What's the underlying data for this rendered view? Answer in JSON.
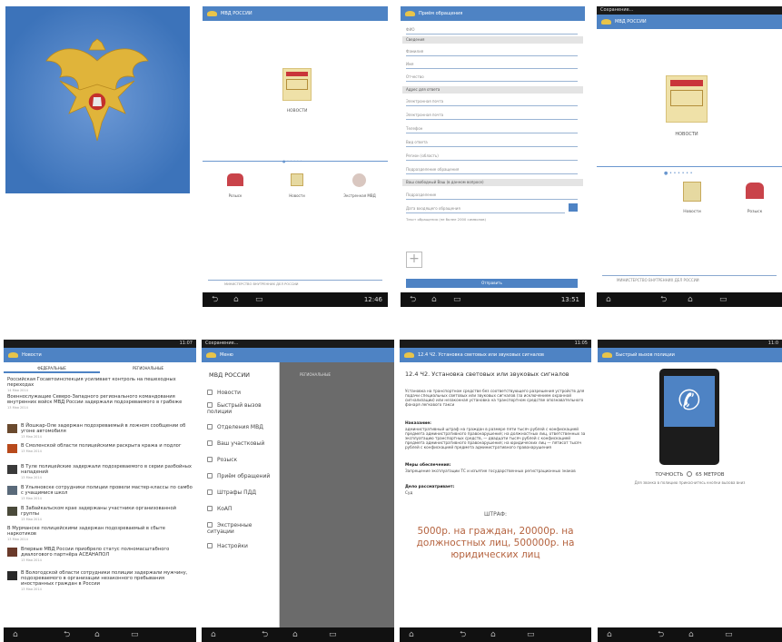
{
  "common": {
    "app_title": "МВД РОССИИ",
    "nav_back": "⮌",
    "nav_home": "⌂",
    "nav_recent": "▭",
    "camera": "⌂"
  },
  "tile2": {
    "news_label": "НОВОСТИ",
    "feature1": "Розыск",
    "feature2": "Новости",
    "feature3": "Экстренная МВД",
    "footer": "МИНИСТЕРСТВО ВНУТРЕННИХ ДЕЛ РОССИИ",
    "clock": "12:46"
  },
  "tile3": {
    "header": "Приём обращения",
    "fields": [
      "ФИО",
      "Фамилия",
      "Имя",
      "Отчество"
    ],
    "sec1": "Сведения",
    "sec2": "Адрес для ответа",
    "addr_fields": [
      "Электронная почта",
      "Электронная почта",
      "Телефон",
      "Вид ответа",
      "Регион (область)",
      "Подразделение обращения"
    ],
    "sec3": "Ваш свободный Ваш (в данном вопросе)",
    "fields2": [
      "Подразделение",
      "Дата входящего обращения"
    ],
    "text_hint": "Текст обращения (не более 2000 символов)",
    "submit": "Отправить",
    "clock": "13:51"
  },
  "tile4": {
    "status": "Сохранение...",
    "news_label": "НОВОСТИ",
    "feature1": "Новости",
    "feature2": "Розыск",
    "footer": "МИНИСТЕРСТВО ВНУТРЕННИХ ДЕЛ РОССИИ"
  },
  "tile5": {
    "clock": "11:07",
    "header": "Новости",
    "tab1": "ФЕДЕРАЛЬНЫЕ",
    "tab2": "РЕГИОНАЛЬНЫЕ",
    "items": [
      {
        "t": "Российская Госавтоинспекция усиливает контроль на пешеходных переходах",
        "d": "14 Мая 2014"
      },
      {
        "t": "Военнослужащие Северо-Западного регионального командования внутренних войск МВД России задержали подозреваемого в грабеже",
        "d": "13 Мая 2014"
      },
      {
        "t": "В Йошкар-Оле задержан подозреваемый в ложном сообщении об угоне автомобиля",
        "d": "13 Мая 2014"
      },
      {
        "t": "В Смоленской области полицейскими раскрыта кража и подлог",
        "d": "13 Мая 2014"
      },
      {
        "t": "В Туле полицейские задержали подозреваемого в серии разбойных нападений",
        "d": "13 Мая 2014"
      },
      {
        "t": "В Ульяновске сотрудники полиции провели мастер-классы по самбо с учащимися школ",
        "d": "13 Мая 2014"
      },
      {
        "t": "В Забайкальском крае задержаны участники организованной группы",
        "d": "13 Мая 2014"
      },
      {
        "t": "В Мурманске полицейскими задержан подозреваемый в сбыте наркотиков",
        "d": "13 Мая 2014"
      },
      {
        "t": "Впервые МВД России приобрело статус полномасштабного диалогового партнёра АСЕАНАПОЛ",
        "d": "13 Мая 2014"
      },
      {
        "t": "В Вологодской области сотрудники полиции задержали мужчину, подозреваемого в организации незаконного пребывания иностранных граждан в России",
        "d": "13 Мая 2014"
      }
    ]
  },
  "tile6": {
    "status": "Сохранение...",
    "header": "Меню",
    "menu_title": "МВД РОССИИ",
    "items": [
      "Новости",
      "Быстрый вызов полиции",
      "Отделения МВД",
      "Ваш участковый",
      "Розыск",
      "Приём обращений",
      "Штрафы ПДД",
      "КоАП",
      "Экстренные ситуации",
      "Настройки"
    ],
    "behind_tab": "РЕГИОНАЛЬНЫЕ"
  },
  "tile7": {
    "clock": "11:05",
    "header": "12.4 Ч2. Установка световых или звуковых сигналов",
    "title": "12.4 Ч2. Установка световых или звуковых сигналов",
    "body": "Установка на транспортном средстве без соответствующего разрешения устройств для подачи специальных световых или звуковых сигналов (за исключением охранной сигнализации) или незаконная установка на транспортном средстве опознавательного фонаря легкового такси",
    "nak_label": "Наказание:",
    "nak_text": "административный штраф на граждан в размере пяти тысяч рублей с конфискацией предмета административного правонарушения; на должностных лиц, ответственных за эксплуатацию транспортных средств, — двадцати тысяч рублей с конфискацией предмета административного правонарушения; на юридических лиц — пятисот тысяч рублей с конфискацией предмета административного правонарушения",
    "add_label": "Меры обеспечения:",
    "add_text": "Запрещение эксплуатации ТС и изъятие государственных регистрационных знаков",
    "who_label": "Дело рассматривает:",
    "who_text": "Суд",
    "fine_label": "ШТРАФ:",
    "fine_text": "5000р. на граждан, 20000р. на должностных лиц, 500000р. на юридических лиц"
  },
  "tile8": {
    "clock": "11:0",
    "header": "Быстрый вызов полиции",
    "accuracy": "ТОЧНОСТЬ",
    "meters": "65 МЕТРОВ",
    "hint": "Для звонка в полицию прикоснитесь кнопки вызова вниз"
  }
}
